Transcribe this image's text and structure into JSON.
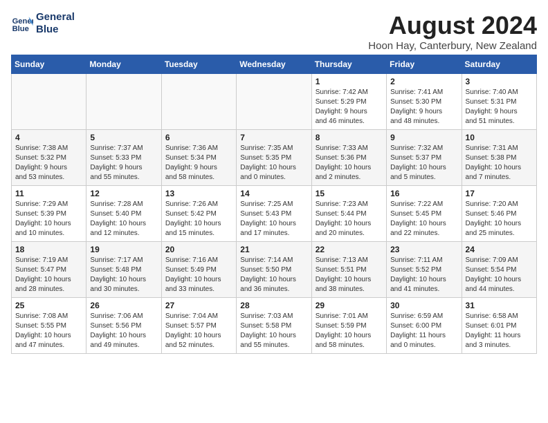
{
  "header": {
    "logo_line1": "General",
    "logo_line2": "Blue",
    "title": "August 2024",
    "subtitle": "Hoon Hay, Canterbury, New Zealand"
  },
  "weekdays": [
    "Sunday",
    "Monday",
    "Tuesday",
    "Wednesday",
    "Thursday",
    "Friday",
    "Saturday"
  ],
  "weeks": [
    [
      {
        "day": "",
        "info": ""
      },
      {
        "day": "",
        "info": ""
      },
      {
        "day": "",
        "info": ""
      },
      {
        "day": "",
        "info": ""
      },
      {
        "day": "1",
        "info": "Sunrise: 7:42 AM\nSunset: 5:29 PM\nDaylight: 9 hours\nand 46 minutes."
      },
      {
        "day": "2",
        "info": "Sunrise: 7:41 AM\nSunset: 5:30 PM\nDaylight: 9 hours\nand 48 minutes."
      },
      {
        "day": "3",
        "info": "Sunrise: 7:40 AM\nSunset: 5:31 PM\nDaylight: 9 hours\nand 51 minutes."
      }
    ],
    [
      {
        "day": "4",
        "info": "Sunrise: 7:38 AM\nSunset: 5:32 PM\nDaylight: 9 hours\nand 53 minutes."
      },
      {
        "day": "5",
        "info": "Sunrise: 7:37 AM\nSunset: 5:33 PM\nDaylight: 9 hours\nand 55 minutes."
      },
      {
        "day": "6",
        "info": "Sunrise: 7:36 AM\nSunset: 5:34 PM\nDaylight: 9 hours\nand 58 minutes."
      },
      {
        "day": "7",
        "info": "Sunrise: 7:35 AM\nSunset: 5:35 PM\nDaylight: 10 hours\nand 0 minutes."
      },
      {
        "day": "8",
        "info": "Sunrise: 7:33 AM\nSunset: 5:36 PM\nDaylight: 10 hours\nand 2 minutes."
      },
      {
        "day": "9",
        "info": "Sunrise: 7:32 AM\nSunset: 5:37 PM\nDaylight: 10 hours\nand 5 minutes."
      },
      {
        "day": "10",
        "info": "Sunrise: 7:31 AM\nSunset: 5:38 PM\nDaylight: 10 hours\nand 7 minutes."
      }
    ],
    [
      {
        "day": "11",
        "info": "Sunrise: 7:29 AM\nSunset: 5:39 PM\nDaylight: 10 hours\nand 10 minutes."
      },
      {
        "day": "12",
        "info": "Sunrise: 7:28 AM\nSunset: 5:40 PM\nDaylight: 10 hours\nand 12 minutes."
      },
      {
        "day": "13",
        "info": "Sunrise: 7:26 AM\nSunset: 5:42 PM\nDaylight: 10 hours\nand 15 minutes."
      },
      {
        "day": "14",
        "info": "Sunrise: 7:25 AM\nSunset: 5:43 PM\nDaylight: 10 hours\nand 17 minutes."
      },
      {
        "day": "15",
        "info": "Sunrise: 7:23 AM\nSunset: 5:44 PM\nDaylight: 10 hours\nand 20 minutes."
      },
      {
        "day": "16",
        "info": "Sunrise: 7:22 AM\nSunset: 5:45 PM\nDaylight: 10 hours\nand 22 minutes."
      },
      {
        "day": "17",
        "info": "Sunrise: 7:20 AM\nSunset: 5:46 PM\nDaylight: 10 hours\nand 25 minutes."
      }
    ],
    [
      {
        "day": "18",
        "info": "Sunrise: 7:19 AM\nSunset: 5:47 PM\nDaylight: 10 hours\nand 28 minutes."
      },
      {
        "day": "19",
        "info": "Sunrise: 7:17 AM\nSunset: 5:48 PM\nDaylight: 10 hours\nand 30 minutes."
      },
      {
        "day": "20",
        "info": "Sunrise: 7:16 AM\nSunset: 5:49 PM\nDaylight: 10 hours\nand 33 minutes."
      },
      {
        "day": "21",
        "info": "Sunrise: 7:14 AM\nSunset: 5:50 PM\nDaylight: 10 hours\nand 36 minutes."
      },
      {
        "day": "22",
        "info": "Sunrise: 7:13 AM\nSunset: 5:51 PM\nDaylight: 10 hours\nand 38 minutes."
      },
      {
        "day": "23",
        "info": "Sunrise: 7:11 AM\nSunset: 5:52 PM\nDaylight: 10 hours\nand 41 minutes."
      },
      {
        "day": "24",
        "info": "Sunrise: 7:09 AM\nSunset: 5:54 PM\nDaylight: 10 hours\nand 44 minutes."
      }
    ],
    [
      {
        "day": "25",
        "info": "Sunrise: 7:08 AM\nSunset: 5:55 PM\nDaylight: 10 hours\nand 47 minutes."
      },
      {
        "day": "26",
        "info": "Sunrise: 7:06 AM\nSunset: 5:56 PM\nDaylight: 10 hours\nand 49 minutes."
      },
      {
        "day": "27",
        "info": "Sunrise: 7:04 AM\nSunset: 5:57 PM\nDaylight: 10 hours\nand 52 minutes."
      },
      {
        "day": "28",
        "info": "Sunrise: 7:03 AM\nSunset: 5:58 PM\nDaylight: 10 hours\nand 55 minutes."
      },
      {
        "day": "29",
        "info": "Sunrise: 7:01 AM\nSunset: 5:59 PM\nDaylight: 10 hours\nand 58 minutes."
      },
      {
        "day": "30",
        "info": "Sunrise: 6:59 AM\nSunset: 6:00 PM\nDaylight: 11 hours\nand 0 minutes."
      },
      {
        "day": "31",
        "info": "Sunrise: 6:58 AM\nSunset: 6:01 PM\nDaylight: 11 hours\nand 3 minutes."
      }
    ]
  ]
}
